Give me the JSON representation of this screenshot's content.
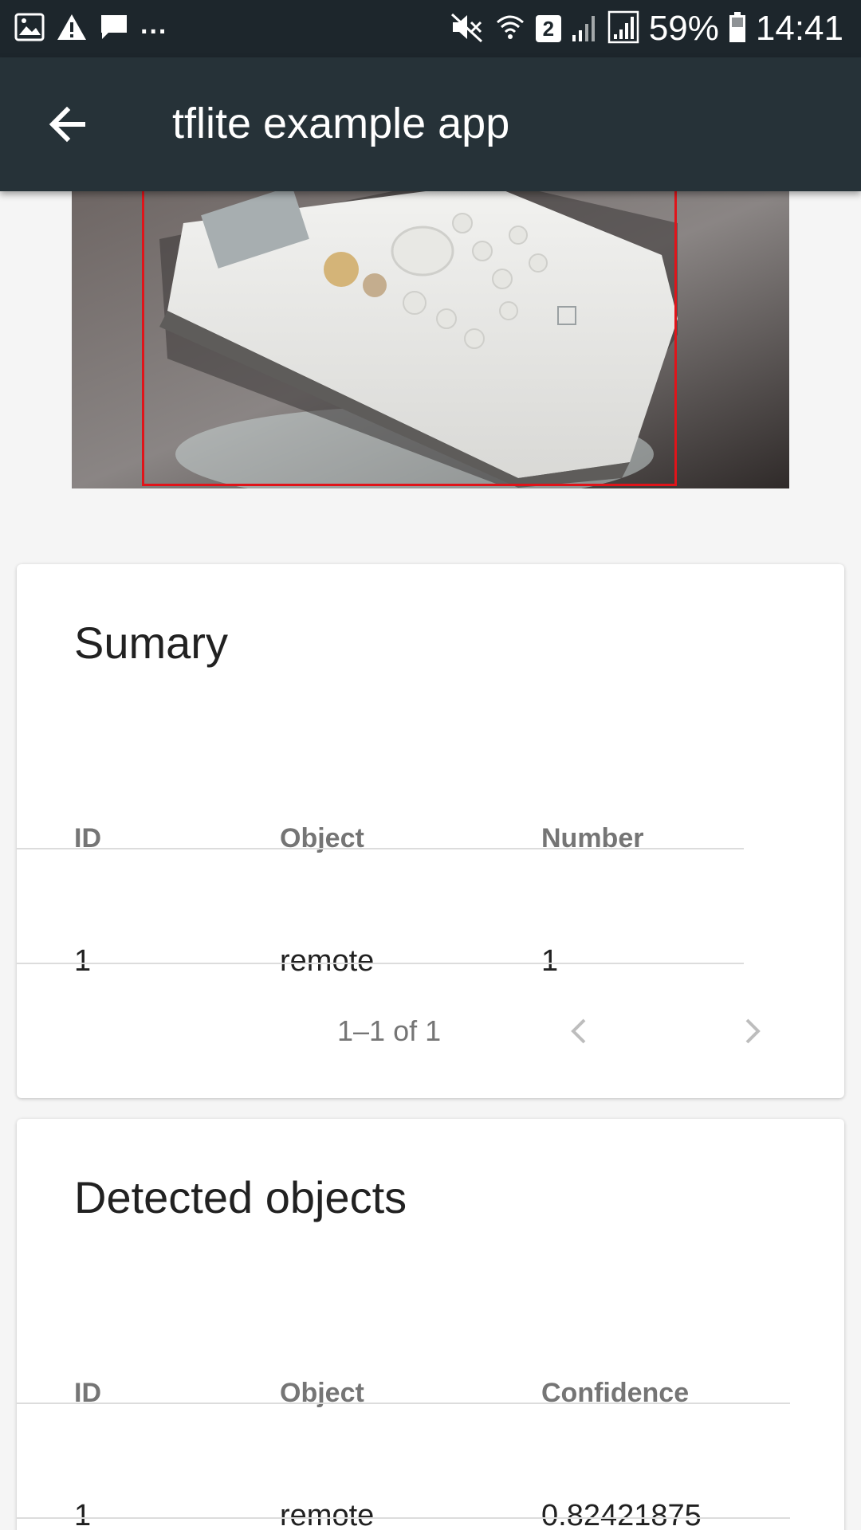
{
  "status_bar": {
    "left_icons": [
      "image-icon",
      "warning-icon",
      "message-icon"
    ],
    "overflow": "...",
    "sim_slot": "2",
    "battery": "59%",
    "time": "14:41"
  },
  "app_bar": {
    "title": "tflite example app",
    "back_icon": "arrow-back-icon"
  },
  "preview": {
    "detection_box_color": "#e0141a"
  },
  "summary": {
    "title": "Sumary",
    "columns": [
      "ID",
      "Object",
      "Number"
    ],
    "rows": [
      [
        "1",
        "remote",
        "1"
      ]
    ],
    "pagination": "1–1 of 1"
  },
  "detected": {
    "title": "Detected objects",
    "columns": [
      "ID",
      "Object",
      "Confidence"
    ],
    "rows": [
      [
        "1",
        "remote",
        "0.82421875"
      ]
    ]
  },
  "colors": {
    "status_bar": "#1d262c",
    "app_bar": "#263238",
    "background": "#f5f5f5"
  }
}
